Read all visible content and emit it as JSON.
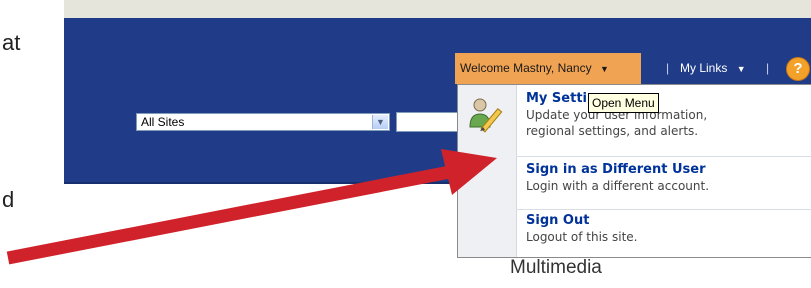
{
  "document": {
    "line1_fragment": "at",
    "line2_fragment": "d",
    "caption": "Multimedia"
  },
  "header": {
    "sites_dropdown": {
      "selected": "All Sites"
    },
    "welcome_label": "Welcome Mastny, Nancy",
    "my_links_label": "My Links",
    "separator": "|",
    "help_icon": "help-icon",
    "help_glyph": "?"
  },
  "tooltip": {
    "text": "Open Menu"
  },
  "menu": {
    "items": [
      {
        "title": "My Settings",
        "desc_line1": "Update your user information,",
        "desc_line2": "regional settings, and alerts.",
        "icon": "user-pencil-icon"
      },
      {
        "title": "Sign in as Different User",
        "desc_line1": "Login with a different account."
      },
      {
        "title": "Sign Out",
        "desc_line1": "Logout of this site."
      }
    ]
  },
  "colors": {
    "banner": "#203c88",
    "welcome_highlight": "#f0a353",
    "menu_title": "#003399",
    "annotation_arrow": "#d0222a"
  }
}
